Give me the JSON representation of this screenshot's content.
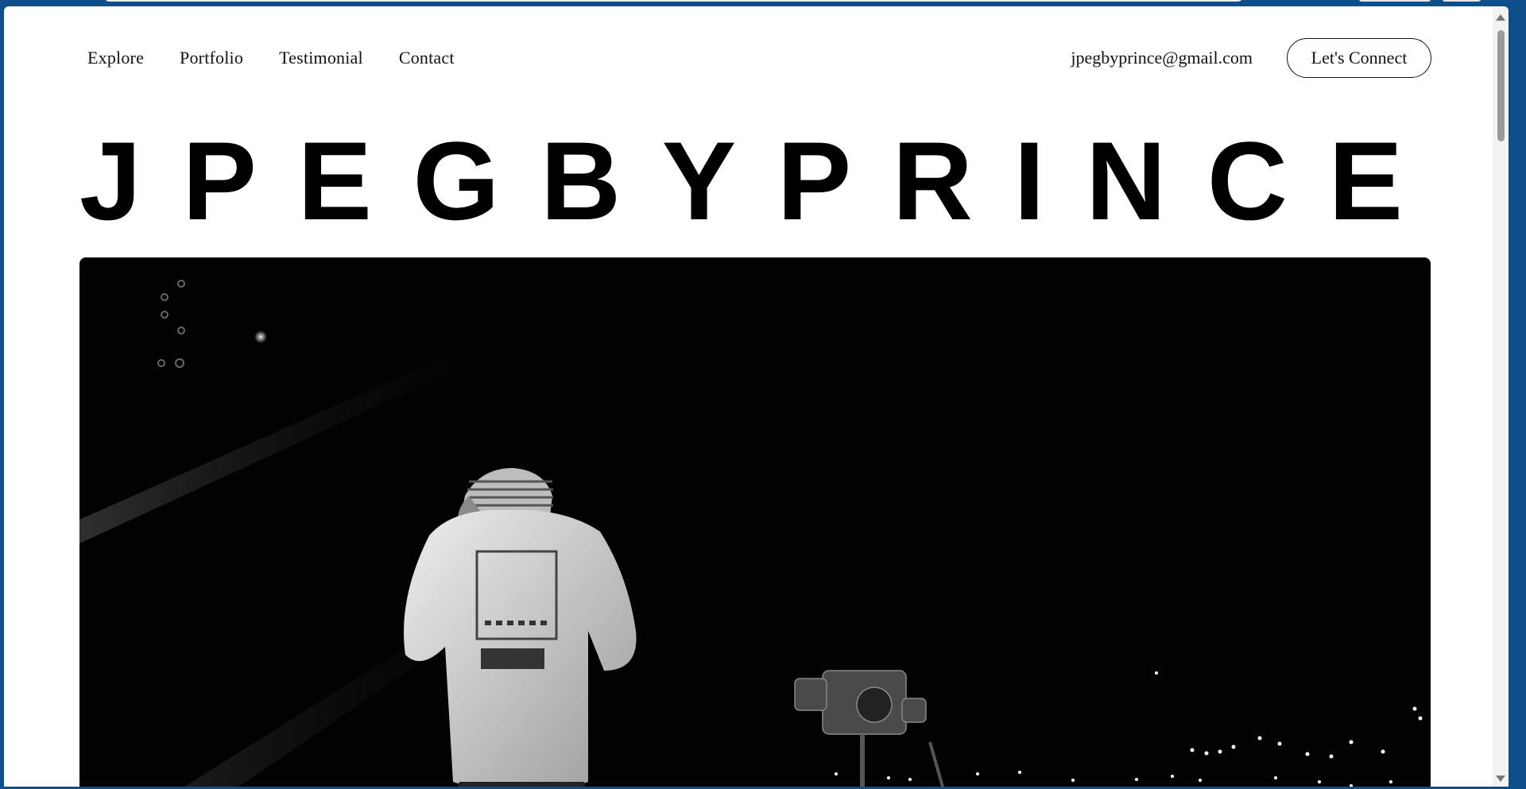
{
  "nav": {
    "items": [
      {
        "label": "Explore"
      },
      {
        "label": "Portfolio"
      },
      {
        "label": "Testimonial"
      },
      {
        "label": "Contact"
      }
    ]
  },
  "header": {
    "email": "jpegbyprince@gmail.com",
    "cta_label": "Let's Connect"
  },
  "hero": {
    "wordmark": [
      "J",
      "P",
      "E",
      "G",
      "B",
      "Y",
      "P",
      "R",
      "I",
      "N",
      "C",
      "E"
    ],
    "photo": "black-and-white concert photo"
  },
  "colors": {
    "frame": "#0d4f8b",
    "page": "#ffffff",
    "text": "#111111",
    "hero_bg": "#020202"
  }
}
